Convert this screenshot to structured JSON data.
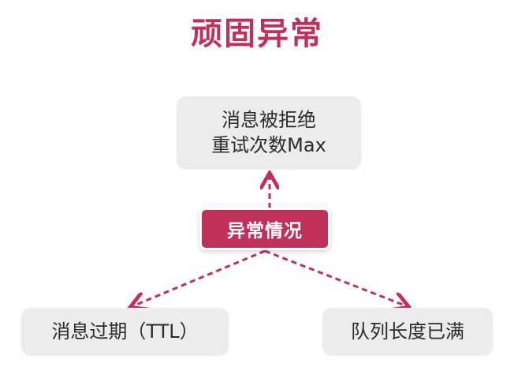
{
  "title": "顽固异常",
  "center_label": "异常情况",
  "nodes": {
    "top": {
      "line1": "消息被拒绝",
      "line2": "重试次数Max"
    },
    "left": {
      "label": "消息过期（TTL）"
    },
    "right": {
      "label": "队列长度已满"
    }
  },
  "colors": {
    "accent": "#c0305a",
    "box_fill": "#ececec",
    "text": "#2b2b2b"
  }
}
